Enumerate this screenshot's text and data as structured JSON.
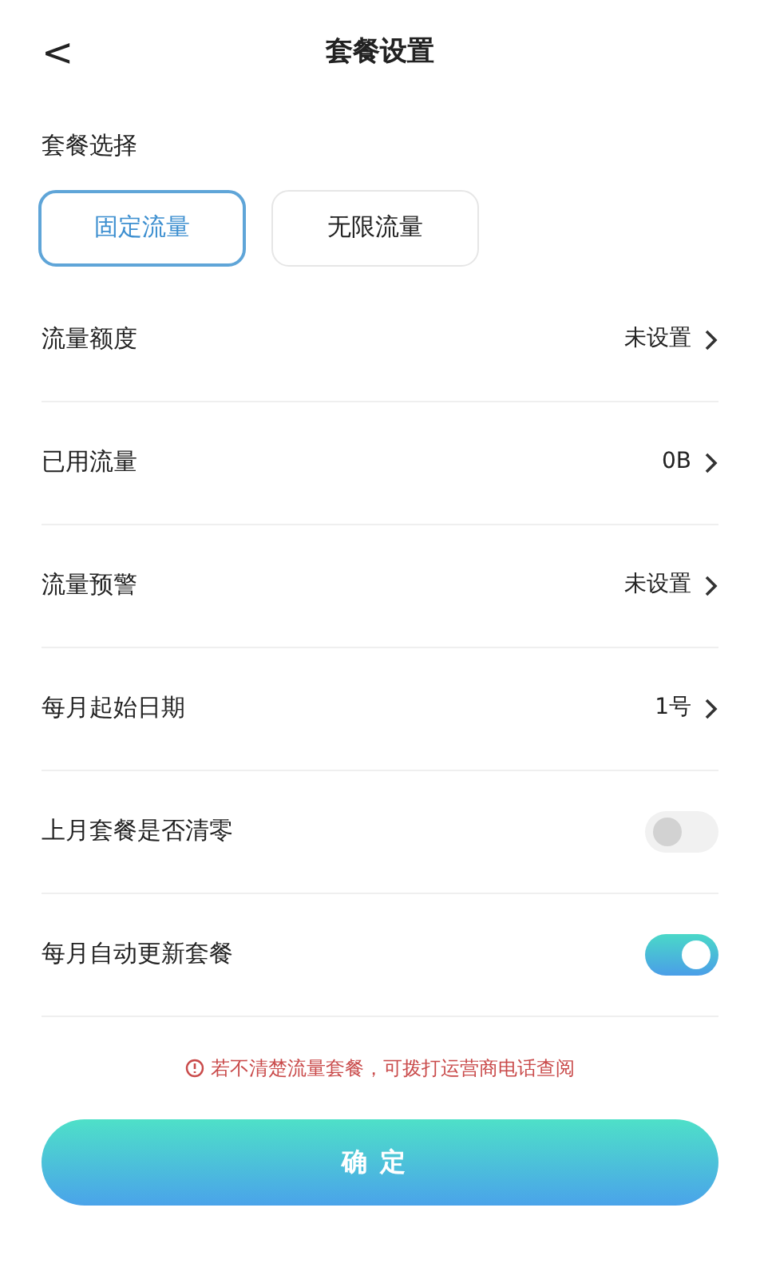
{
  "header": {
    "back": "<",
    "title": "套餐设置"
  },
  "plan": {
    "label": "套餐选择",
    "options": [
      {
        "label": "固定流量",
        "selected": true
      },
      {
        "label": "无限流量",
        "selected": false
      }
    ]
  },
  "rows": [
    {
      "kind": "link",
      "label": "流量额度",
      "value": "未设置"
    },
    {
      "kind": "link",
      "label": "已用流量",
      "value": "0B"
    },
    {
      "kind": "link",
      "label": "流量预警",
      "value": "未设置"
    },
    {
      "kind": "link",
      "label": "每月起始日期",
      "value": "1号"
    },
    {
      "kind": "toggle",
      "label": "上月套餐是否清零",
      "on": false
    },
    {
      "kind": "toggle",
      "label": "每月自动更新套餐",
      "on": true
    }
  ],
  "notice": "若不清楚流量套餐，可拨打运营商电话查阅",
  "confirm": "确定"
}
